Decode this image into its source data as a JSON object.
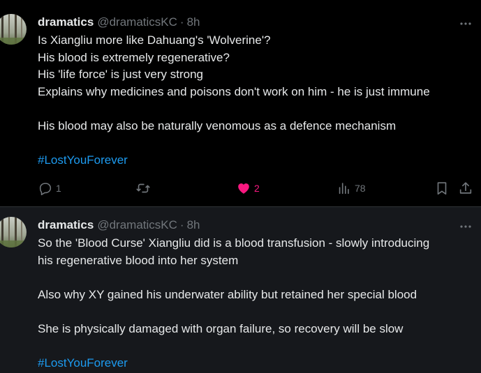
{
  "colors": {
    "background": "#000000",
    "background_alt": "#16181c",
    "text": "#e7e9ea",
    "muted": "#71767b",
    "link": "#1d9bf0",
    "like_active": "#f91880"
  },
  "tweets": [
    {
      "display_name": "dramatics",
      "handle": "@dramaticsKC",
      "separator": "·",
      "time": "8h",
      "lines": [
        "Is Xiangliu more like Dahuang's 'Wolverine'?",
        "His blood is extremely regenerative?",
        "His 'life force' is just very strong",
        "Explains why medicines and poisons don't work on him - he is just immune",
        "",
        "His blood may also be naturally venomous as a defence mechanism",
        ""
      ],
      "hashtag": "#LostYouForever",
      "actions": {
        "reply_count": "1",
        "retweet_count": "",
        "like_count": "2",
        "view_count": "78",
        "liked": true
      },
      "icons": [
        "reply-icon",
        "retweet-icon",
        "heart-icon",
        "views-icon",
        "bookmark-icon",
        "share-icon",
        "more-icon"
      ]
    },
    {
      "display_name": "dramatics",
      "handle": "@dramaticsKC",
      "separator": "·",
      "time": "8h",
      "lines": [
        "So the 'Blood Curse' Xiangliu did is a blood transfusion - slowly introducing",
        "his regenerative blood into her system",
        "",
        "Also why XY gained his underwater ability but retained her special blood",
        "",
        "She is physically damaged with organ failure, so recovery will be slow",
        ""
      ],
      "hashtag": "#LostYouForever"
    }
  ]
}
